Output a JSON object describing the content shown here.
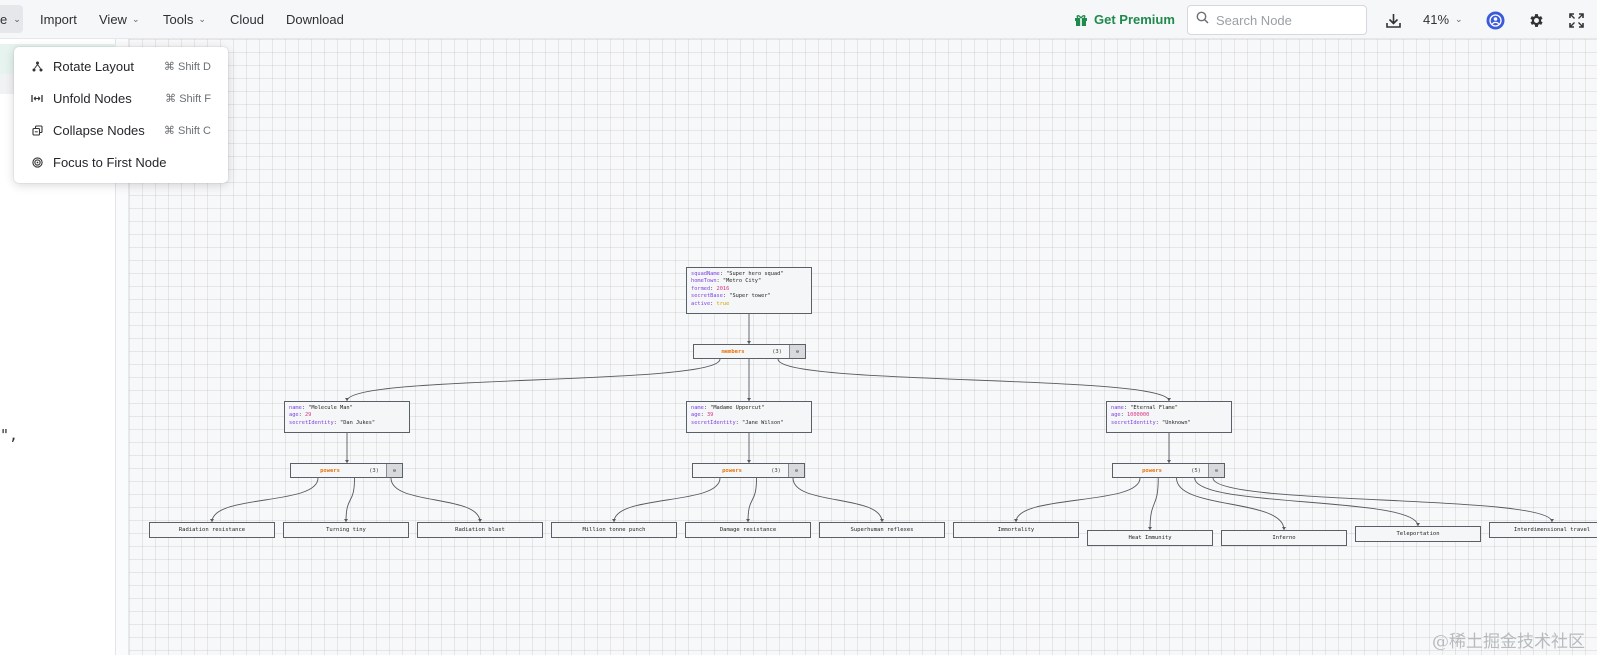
{
  "topbar": {
    "active_menu_label": "e",
    "nav": [
      {
        "label": "Import",
        "has_chevron": false
      },
      {
        "label": "View",
        "has_chevron": true
      },
      {
        "label": "Tools",
        "has_chevron": true
      },
      {
        "label": "Cloud",
        "has_chevron": false
      },
      {
        "label": "Download",
        "has_chevron": false
      }
    ],
    "premium_label": "Get Premium",
    "premium_color": "#1f8a4c",
    "search_placeholder": "Search Node",
    "zoom_label": "41%",
    "icons": [
      "download-icon",
      "account-icon",
      "gear-icon",
      "fullscreen-icon"
    ]
  },
  "editor": {
    "visible_text": "\","
  },
  "dropdown": {
    "items": [
      {
        "label": "Rotate Layout",
        "shortcut": "⌘ Shift D",
        "icon": "rotate-layout-icon"
      },
      {
        "label": "Unfold Nodes",
        "shortcut": "⌘ Shift F",
        "icon": "unfold-icon"
      },
      {
        "label": "Collapse Nodes",
        "shortcut": "⌘ Shift C",
        "icon": "collapse-icon"
      },
      {
        "label": "Focus to First Node",
        "shortcut": "",
        "icon": "target-icon"
      }
    ]
  },
  "graph": {
    "root": {
      "lines": [
        {
          "key": "squadName",
          "value": "\"Super hero squad\"",
          "type": "string"
        },
        {
          "key": "homeTown",
          "value": "\"Metro City\"",
          "type": "string"
        },
        {
          "key": "formed",
          "value": "2016",
          "type": "number"
        },
        {
          "key": "secretBase",
          "value": "\"Super tower\"",
          "type": "string"
        },
        {
          "key": "active",
          "value": "true",
          "type": "bool"
        }
      ]
    },
    "members_node": {
      "label": "members",
      "count": "(3)"
    },
    "members": [
      {
        "lines": [
          {
            "key": "name",
            "value": "\"Molecule Man\"",
            "type": "string"
          },
          {
            "key": "age",
            "value": "29",
            "type": "number"
          },
          {
            "key": "secretIdentity",
            "value": "\"Dan Jukes\"",
            "type": "string"
          }
        ],
        "powers_label": "powers",
        "powers_count": "(3)",
        "powers": [
          "Radiation resistance",
          "Turning tiny",
          "Radiation blast"
        ]
      },
      {
        "lines": [
          {
            "key": "name",
            "value": "\"Madame Uppercut\"",
            "type": "string"
          },
          {
            "key": "age",
            "value": "39",
            "type": "number"
          },
          {
            "key": "secretIdentity",
            "value": "\"Jane Wilson\"",
            "type": "string"
          }
        ],
        "powers_label": "powers",
        "powers_count": "(3)",
        "powers": [
          "Million tonne punch",
          "Damage resistance",
          "Superhuman reflexes"
        ]
      },
      {
        "lines": [
          {
            "key": "name",
            "value": "\"Eternal Flame\"",
            "type": "string"
          },
          {
            "key": "age",
            "value": "1000000",
            "type": "number"
          },
          {
            "key": "secretIdentity",
            "value": "\"Unknown\"",
            "type": "string"
          }
        ],
        "powers_label": "powers",
        "powers_count": "(5)",
        "powers": [
          "Immortality",
          "Heat Immunity",
          "Inferno",
          "Teleportation",
          "Interdimensional travel"
        ]
      }
    ]
  },
  "watermark": "@稀土掘金技术社区"
}
